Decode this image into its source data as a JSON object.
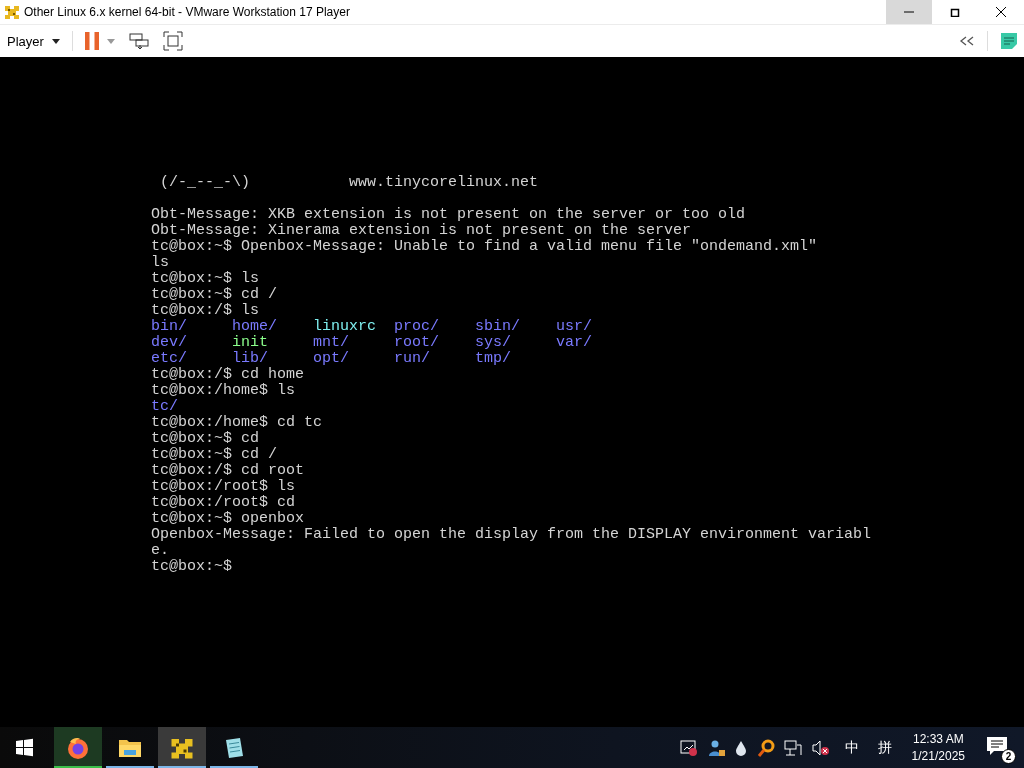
{
  "window": {
    "title": "Other Linux 6.x kernel 64-bit - VMware Workstation 17 Player",
    "controls": [
      {
        "kind": "minimize",
        "highlighted": true
      },
      {
        "kind": "maximize",
        "highlighted": false
      },
      {
        "kind": "close",
        "highlighted": false
      }
    ]
  },
  "toolbar": {
    "menu": "Player"
  },
  "terminal": {
    "lines": [
      {
        "kind": "text",
        "text": " (/-_--_-\\)           www.tinycorelinux.net"
      },
      {
        "kind": "blank"
      },
      {
        "kind": "text",
        "text": "Obt-Message: XKB extension is not present on the server or too old"
      },
      {
        "kind": "text",
        "text": "Obt-Message: Xinerama extension is not present on the server"
      },
      {
        "kind": "text",
        "text": "tc@box:~$ Openbox-Message: Unable to find a valid menu file \"ondemand.xml\""
      },
      {
        "kind": "text",
        "text": "ls"
      },
      {
        "kind": "text",
        "text": "tc@box:~$ ls"
      },
      {
        "kind": "text",
        "text": "tc@box:~$ cd /"
      },
      {
        "kind": "text",
        "text": "tc@box:/$ ls"
      },
      {
        "kind": "listing",
        "entries": [
          {
            "text": "bin/",
            "color": "#7a7aff"
          },
          {
            "text": "home/",
            "color": "#7a7aff"
          },
          {
            "text": "linuxrc",
            "color": "#7ff0f0"
          },
          {
            "text": "proc/",
            "color": "#7a7aff"
          },
          {
            "text": "sbin/",
            "color": "#7a7aff"
          },
          {
            "text": "usr/",
            "color": "#7a7aff"
          }
        ]
      },
      {
        "kind": "listing",
        "entries": [
          {
            "text": "dev/",
            "color": "#7a7aff"
          },
          {
            "text": "init",
            "color": "#8cff8c"
          },
          {
            "text": "mnt/",
            "color": "#7a7aff"
          },
          {
            "text": "root/",
            "color": "#7a7aff"
          },
          {
            "text": "sys/",
            "color": "#7a7aff"
          },
          {
            "text": "var/",
            "color": "#7a7aff"
          }
        ]
      },
      {
        "kind": "listing",
        "entries": [
          {
            "text": "etc/",
            "color": "#7a7aff"
          },
          {
            "text": "lib/",
            "color": "#7a7aff"
          },
          {
            "text": "opt/",
            "color": "#7a7aff"
          },
          {
            "text": "run/",
            "color": "#7a7aff"
          },
          {
            "text": "tmp/",
            "color": "#7a7aff"
          }
        ]
      },
      {
        "kind": "text",
        "text": "tc@box:/$ cd home"
      },
      {
        "kind": "text",
        "text": "tc@box:/home$ ls"
      },
      {
        "kind": "listing",
        "entries": [
          {
            "text": "tc/",
            "color": "#7a7aff"
          }
        ]
      },
      {
        "kind": "text",
        "text": "tc@box:/home$ cd tc"
      },
      {
        "kind": "text",
        "text": "tc@box:~$ cd"
      },
      {
        "kind": "text",
        "text": "tc@box:~$ cd /"
      },
      {
        "kind": "text",
        "text": "tc@box:/$ cd root"
      },
      {
        "kind": "text",
        "text": "tc@box:/root$ ls"
      },
      {
        "kind": "text",
        "text": "tc@box:/root$ cd"
      },
      {
        "kind": "text",
        "text": "tc@box:~$ openbox"
      },
      {
        "kind": "text",
        "text": "Openbox-Message: Failed to open the display from the DISPLAY environment variabl"
      },
      {
        "kind": "text",
        "text": "e."
      },
      {
        "kind": "text",
        "text": "tc@box:~$"
      }
    ]
  },
  "taskbar": {
    "apps": [
      {
        "kind": "browser",
        "selected": false,
        "running": true
      },
      {
        "kind": "folder",
        "selected": false,
        "running": true
      },
      {
        "kind": "vmware",
        "selected": true,
        "running": true
      },
      {
        "kind": "notepad",
        "selected": false,
        "running": true
      }
    ],
    "tray": {
      "ime_mode": "中",
      "ime_layout": "拼",
      "time": "12:33 AM",
      "date": "1/21/2025",
      "notification_count": "2"
    }
  }
}
